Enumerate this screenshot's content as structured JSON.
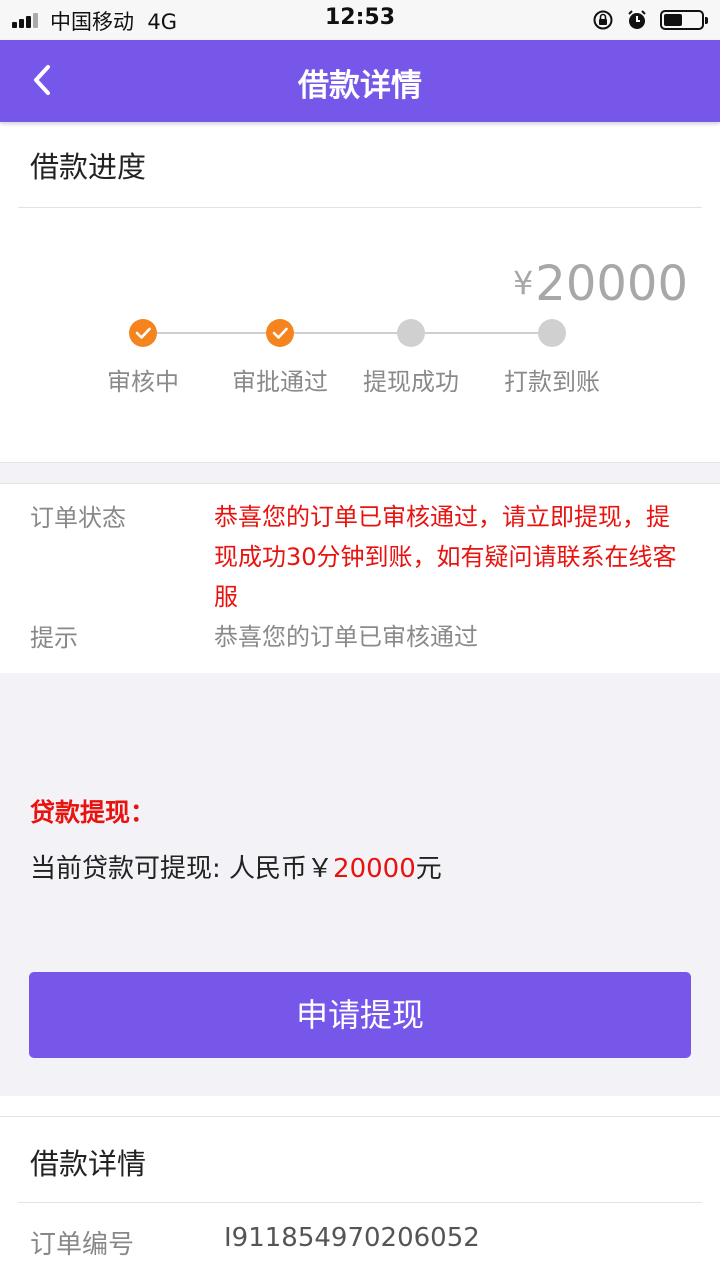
{
  "status_bar": {
    "carrier": "中国移动",
    "network": "4G",
    "time": "12:53"
  },
  "nav": {
    "title": "借款详情"
  },
  "progress": {
    "title": "借款进度",
    "currency_symbol": "¥",
    "amount": "20000",
    "steps": [
      {
        "label": "审核中",
        "done": true
      },
      {
        "label": "审批通过",
        "done": true
      },
      {
        "label": "提现成功",
        "done": false
      },
      {
        "label": "打款到账",
        "done": false
      }
    ]
  },
  "order_status": {
    "label": "订单状态",
    "text": "恭喜您的订单已审核通过，请立即提现，提现成功30分钟到账，如有疑问请联系在线客服"
  },
  "tip": {
    "label": "提示",
    "text": "恭喜您的订单已审核通过"
  },
  "withdraw": {
    "title": "贷款提现：",
    "prefix": "当前贷款可提现: 人民币￥",
    "amount": "20000",
    "suffix": "元",
    "button": "申请提现"
  },
  "details": {
    "title": "借款详情",
    "order_no_label": "订单编号",
    "order_no": "I911854970206052"
  },
  "colors": {
    "primary": "#7657e9",
    "accent_red": "#e8130f",
    "step_done": "#f5841f",
    "step_todo": "#d0d0d0"
  }
}
